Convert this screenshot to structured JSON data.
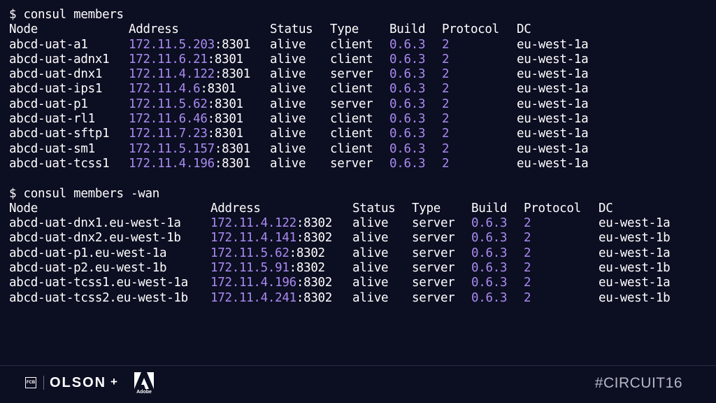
{
  "terminal": {
    "cmd1": "$ consul members",
    "cmd2": "$ consul members -wan",
    "headers": {
      "node": "Node",
      "address": "Address",
      "status": "Status",
      "type": "Type",
      "build": "Build",
      "protocol": "Protocol",
      "dc": "DC"
    },
    "table1": [
      {
        "node": "abcd-uat-a1",
        "ip": "172.11.5.203",
        "port": ":8301",
        "status": "alive",
        "type": "client",
        "build": "0.6.3",
        "protocol": "2",
        "dc": "eu-west-1a"
      },
      {
        "node": "abcd-uat-adnx1",
        "ip": "172.11.6.21",
        "port": ":8301",
        "status": "alive",
        "type": "client",
        "build": "0.6.3",
        "protocol": "2",
        "dc": "eu-west-1a"
      },
      {
        "node": "abcd-uat-dnx1",
        "ip": "172.11.4.122",
        "port": ":8301",
        "status": "alive",
        "type": "server",
        "build": "0.6.3",
        "protocol": "2",
        "dc": "eu-west-1a"
      },
      {
        "node": "abcd-uat-ips1",
        "ip": "172.11.4.6",
        "port": ":8301",
        "status": "alive",
        "type": "client",
        "build": "0.6.3",
        "protocol": "2",
        "dc": "eu-west-1a"
      },
      {
        "node": "abcd-uat-p1",
        "ip": "172.11.5.62",
        "port": ":8301",
        "status": "alive",
        "type": "server",
        "build": "0.6.3",
        "protocol": "2",
        "dc": "eu-west-1a"
      },
      {
        "node": "abcd-uat-rl1",
        "ip": "172.11.6.46",
        "port": ":8301",
        "status": "alive",
        "type": "client",
        "build": "0.6.3",
        "protocol": "2",
        "dc": "eu-west-1a"
      },
      {
        "node": "abcd-uat-sftp1",
        "ip": "172.11.7.23",
        "port": ":8301",
        "status": "alive",
        "type": "client",
        "build": "0.6.3",
        "protocol": "2",
        "dc": "eu-west-1a"
      },
      {
        "node": "abcd-uat-sm1",
        "ip": "172.11.5.157",
        "port": ":8301",
        "status": "alive",
        "type": "client",
        "build": "0.6.3",
        "protocol": "2",
        "dc": "eu-west-1a"
      },
      {
        "node": "abcd-uat-tcss1",
        "ip": "172.11.4.196",
        "port": ":8301",
        "status": "alive",
        "type": "server",
        "build": "0.6.3",
        "protocol": "2",
        "dc": "eu-west-1a"
      }
    ],
    "table2": [
      {
        "node": "abcd-uat-dnx1.eu-west-1a",
        "ip": "172.11.4.122",
        "port": ":8302",
        "status": "alive",
        "type": "server",
        "build": "0.6.3",
        "protocol": "2",
        "dc": "eu-west-1a"
      },
      {
        "node": "abcd-uat-dnx2.eu-west-1b",
        "ip": "172.11.4.141",
        "port": ":8302",
        "status": "alive",
        "type": "server",
        "build": "0.6.3",
        "protocol": "2",
        "dc": "eu-west-1b"
      },
      {
        "node": "abcd-uat-p1.eu-west-1a",
        "ip": "172.11.5.62",
        "port": ":8302",
        "status": "alive",
        "type": "server",
        "build": "0.6.3",
        "protocol": "2",
        "dc": "eu-west-1a"
      },
      {
        "node": "abcd-uat-p2.eu-west-1b",
        "ip": "172.11.5.91",
        "port": ":8302",
        "status": "alive",
        "type": "server",
        "build": "0.6.3",
        "protocol": "2",
        "dc": "eu-west-1b"
      },
      {
        "node": "abcd-uat-tcss1.eu-west-1a",
        "ip": "172.11.4.196",
        "port": ":8302",
        "status": "alive",
        "type": "server",
        "build": "0.6.3",
        "protocol": "2",
        "dc": "eu-west-1a"
      },
      {
        "node": "abcd-uat-tcss2.eu-west-1b",
        "ip": "172.11.4.241",
        "port": ":8302",
        "status": "alive",
        "type": "server",
        "build": "0.6.3",
        "protocol": "2",
        "dc": "eu-west-1b"
      }
    ]
  },
  "footer": {
    "fcb_logo": "FCB",
    "olson_logo": "OLSON",
    "plus": "+",
    "adobe_logo": "Adobe",
    "hashtag": "#CIRCUIT16"
  },
  "colors": {
    "background": "#0c0e22",
    "text": "#ffffff",
    "accent_purple": "#a98bf0",
    "hashtag_gray": "#b5b7c4"
  },
  "icons": {
    "fcb": "fcb-logo-icon",
    "adobe": "adobe-logo-icon"
  }
}
